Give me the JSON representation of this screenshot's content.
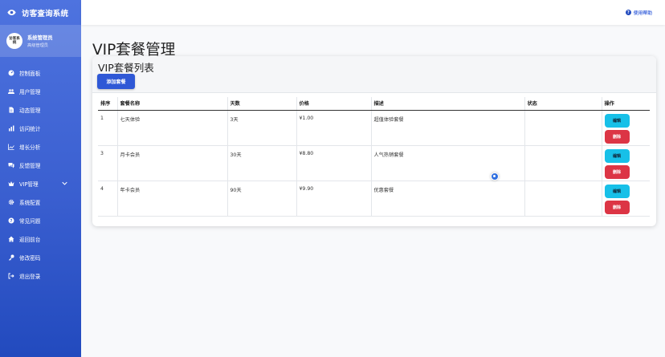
{
  "app": {
    "title": "访客查询系统"
  },
  "user": {
    "avatar_text": "访客系统",
    "name": "系统管理员",
    "role": "高级管理员"
  },
  "sidebar": {
    "items": [
      {
        "label": "控制面板",
        "icon": "dashboard-icon"
      },
      {
        "label": "用户管理",
        "icon": "users-icon"
      },
      {
        "label": "动态管理",
        "icon": "file-icon"
      },
      {
        "label": "访问统计",
        "icon": "bar-chart-icon"
      },
      {
        "label": "增长分析",
        "icon": "line-chart-icon"
      },
      {
        "label": "反馈管理",
        "icon": "comments-icon"
      },
      {
        "label": "VIP管理",
        "icon": "crown-icon",
        "has_submenu": true
      },
      {
        "label": "系统配置",
        "icon": "gear-icon"
      },
      {
        "label": "常见问题",
        "icon": "question-icon"
      },
      {
        "label": "返回前台",
        "icon": "home-icon"
      },
      {
        "label": "修改密码",
        "icon": "key-icon"
      },
      {
        "label": "退出登录",
        "icon": "logout-icon"
      }
    ]
  },
  "topbar": {
    "help_label": "使用帮助"
  },
  "page": {
    "title": "VIP套餐管理"
  },
  "card": {
    "title": "VIP套餐列表",
    "add_button": "添加套餐"
  },
  "table": {
    "headers": [
      "排序",
      "套餐名称",
      "天数",
      "价格",
      "描述",
      "状态",
      "操作"
    ],
    "rows": [
      {
        "order": "1",
        "name": "七天体验",
        "days": "3天",
        "price": "¥1.00",
        "desc": "超值体验套餐",
        "status": ""
      },
      {
        "order": "3",
        "name": "月卡会员",
        "days": "30天",
        "price": "¥8.80",
        "desc": "人气热销套餐",
        "status": ""
      },
      {
        "order": "4",
        "name": "年卡会员",
        "days": "90天",
        "price": "¥9.90",
        "desc": "优惠套餐",
        "status": ""
      }
    ],
    "edit_label": "编辑",
    "delete_label": "删除"
  },
  "colors": {
    "sidebar_top": "#4e73df",
    "sidebar_bottom": "#224abe",
    "primary": "#2f58d6",
    "info": "#17c0e8",
    "danger": "#dc3545"
  }
}
